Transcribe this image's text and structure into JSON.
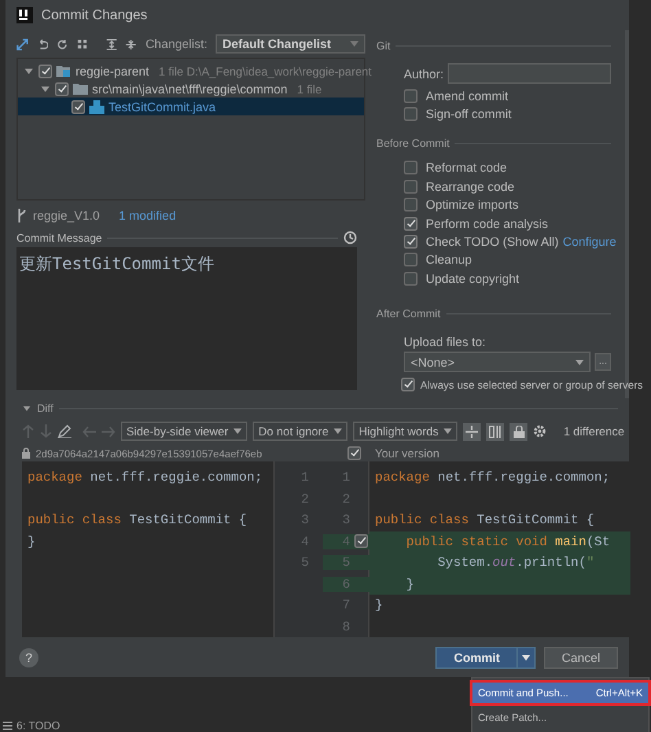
{
  "window": {
    "title": "Commit Changes"
  },
  "toolbar": {
    "changelist_label": "Changelist:",
    "changelist": "Default Changelist"
  },
  "tree": [
    {
      "label": "reggie-parent",
      "meta": "1 file  D:\\A_Feng\\idea_work\\reggie-parent",
      "checked": true,
      "expanded": true,
      "selected": false,
      "kind": "module",
      "children": [
        {
          "label": "src\\main\\java\\net\\fff\\reggie\\common",
          "meta": "1 file",
          "checked": true,
          "expanded": true,
          "selected": false,
          "kind": "folder",
          "children": [
            {
              "label": "TestGitCommit.java",
              "checked": true,
              "selected": true,
              "kind": "file"
            }
          ]
        }
      ]
    }
  ],
  "branch": {
    "name": "reggie_V1.0",
    "status": "1 modified"
  },
  "commit_message": {
    "label": "Commit Message",
    "value": "更新TestGitCommit文件"
  },
  "git": {
    "title": "Git",
    "author_label": "Author:",
    "options": [
      {
        "label": "Amend commit",
        "checked": false
      },
      {
        "label": "Sign-off commit",
        "checked": false
      }
    ]
  },
  "before_commit": {
    "title": "Before Commit",
    "options": [
      {
        "label": "Reformat code",
        "checked": false
      },
      {
        "label": "Rearrange code",
        "checked": false
      },
      {
        "label": "Optimize imports",
        "checked": false
      },
      {
        "label": "Perform code analysis",
        "checked": true
      },
      {
        "label": "Check TODO (Show All)",
        "checked": true,
        "link": "Configure"
      },
      {
        "label": "Cleanup",
        "checked": false
      },
      {
        "label": "Update copyright",
        "checked": false
      }
    ]
  },
  "after_commit": {
    "title": "After Commit",
    "upload_label": "Upload files to:",
    "upload_value": "<None>",
    "browse": "...",
    "always_label": "Always use selected server or group of servers",
    "always_checked": true
  },
  "diff": {
    "title": "Diff",
    "expanded": true,
    "viewer": "Side-by-side viewer",
    "ignore": "Do not ignore",
    "highlight": "Highlight words",
    "differences": "1 difference",
    "left_title": "2d9a7064a2147a06b94297e15391057e4aef76eb",
    "right_checked": true,
    "right_title": "Your version",
    "rows": [
      {
        "left_num": "1",
        "right_num": "1",
        "changed": false,
        "left": [
          {
            "text": "package",
            "kind": "keyword"
          },
          {
            "text": " net.fff.reggie.common;",
            "kind": "plain"
          }
        ],
        "right": [
          {
            "text": "package",
            "kind": "keyword"
          },
          {
            "text": " net.fff.reggie.common;",
            "kind": "plain"
          }
        ]
      },
      {
        "left_num": "2",
        "right_num": "2",
        "changed": false
      },
      {
        "left_num": "3",
        "right_num": "3",
        "changed": false,
        "left": [
          {
            "text": "public class",
            "kind": "keyword"
          },
          {
            "text": " TestGitCommit {",
            "kind": "plain"
          }
        ],
        "right": [
          {
            "text": "public class",
            "kind": "keyword"
          },
          {
            "text": " TestGitCommit {",
            "kind": "plain"
          }
        ]
      },
      {
        "left_num": "4",
        "right_num": "4",
        "changed": true,
        "checked": true,
        "left": [
          {
            "text": "}",
            "kind": "plain"
          }
        ],
        "right": [
          {
            "text": "    public static void",
            "kind": "keyword"
          },
          {
            "text": " main",
            "kind": "method"
          },
          {
            "text": "(St",
            "kind": "plain"
          }
        ]
      },
      {
        "left_num": "5",
        "right_num": "5",
        "changed": true,
        "right": [
          {
            "text": "        System.",
            "kind": "plain"
          },
          {
            "text": "out",
            "kind": "field"
          },
          {
            "text": ".println(",
            "kind": "plain"
          },
          {
            "text": "\"",
            "kind": "string"
          }
        ]
      },
      {
        "right_num": "6",
        "changed": true,
        "right": [
          {
            "text": "    }",
            "kind": "plain"
          }
        ]
      },
      {
        "right_num": "7",
        "changed": false,
        "right": [
          {
            "text": "}",
            "kind": "plain"
          }
        ]
      },
      {
        "right_num": "8",
        "changed": false
      }
    ]
  },
  "buttons": {
    "help": "?",
    "commit": "Commit",
    "cancel": "Cancel"
  },
  "popup": [
    {
      "label": "Commit and Push...",
      "shortcut": "Ctrl+Alt+K",
      "selected": true,
      "annotated": true
    },
    {
      "label": "Create Patch...",
      "selected": false,
      "annotated": false
    }
  ],
  "status_bar": {
    "todo": "6: TODO"
  }
}
